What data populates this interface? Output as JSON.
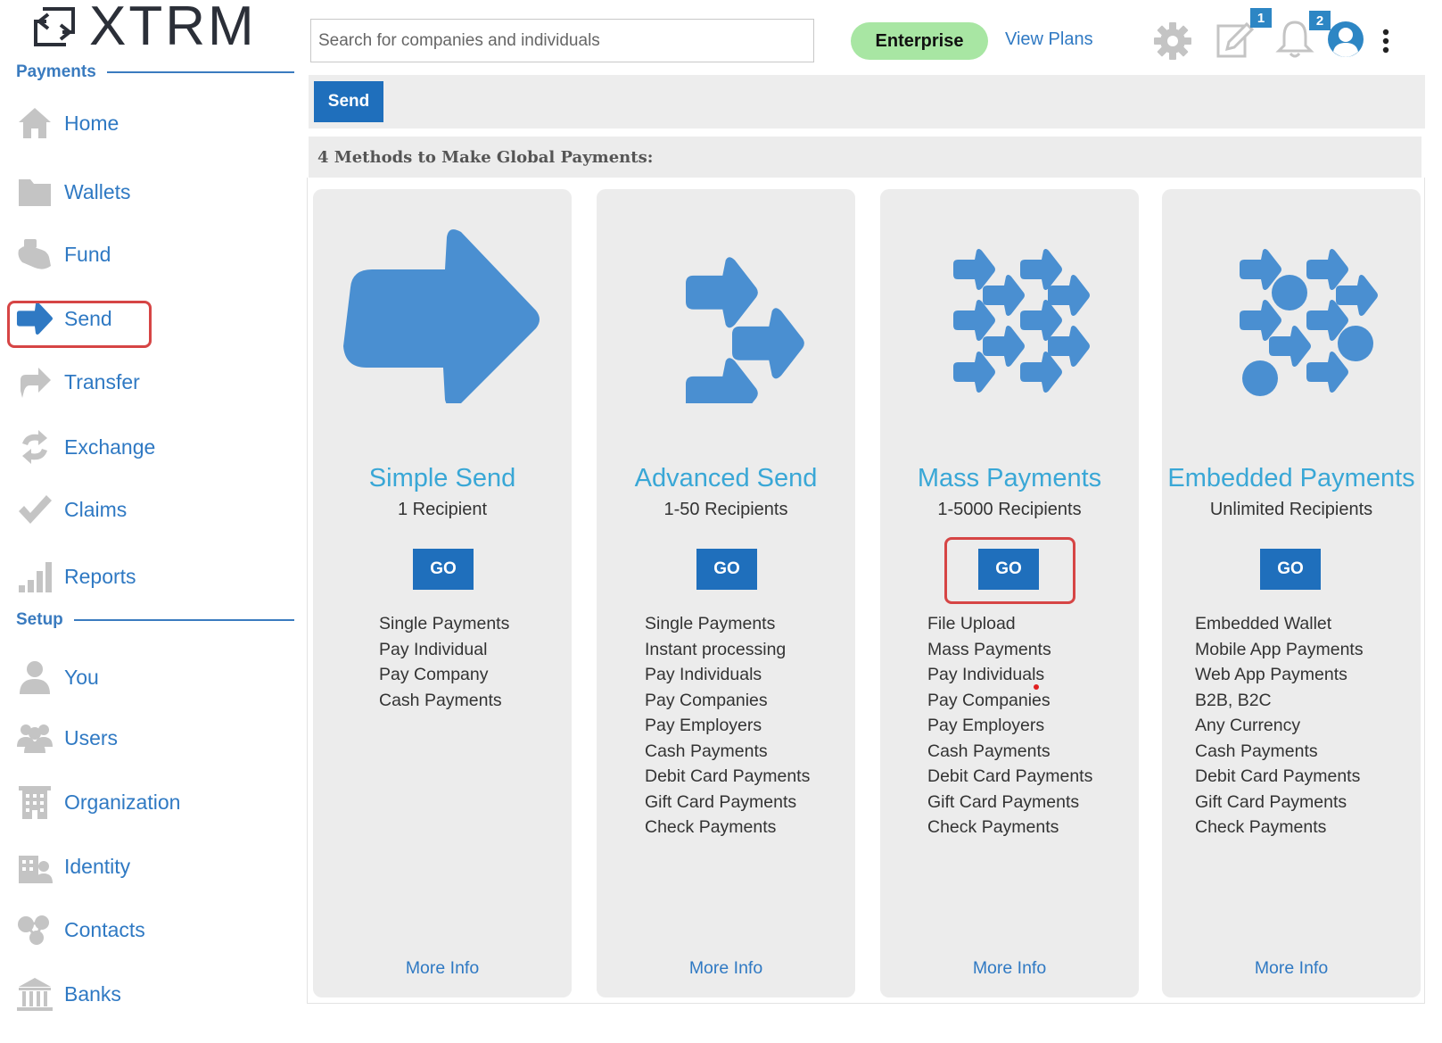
{
  "app": {
    "logo_text": "XTRM"
  },
  "header": {
    "search_placeholder": "Search for companies and individuals",
    "plan_badge": "Enterprise",
    "view_plans": "View Plans",
    "notes_count": "1",
    "notifications_count": "2"
  },
  "sidebar": {
    "payments_heading": "Payments",
    "setup_heading": "Setup",
    "payments_items": [
      {
        "label": "Home",
        "icon": "home-icon"
      },
      {
        "label": "Wallets",
        "icon": "folder-icon"
      },
      {
        "label": "Fund",
        "icon": "hand-icon"
      },
      {
        "label": "Send",
        "icon": "send-arrow-icon"
      },
      {
        "label": "Transfer",
        "icon": "transfer-icon"
      },
      {
        "label": "Exchange",
        "icon": "exchange-icon"
      },
      {
        "label": "Claims",
        "icon": "check-icon"
      },
      {
        "label": "Reports",
        "icon": "bar-chart-icon"
      }
    ],
    "setup_items": [
      {
        "label": "You",
        "icon": "user-icon"
      },
      {
        "label": "Users",
        "icon": "users-icon"
      },
      {
        "label": "Organization",
        "icon": "building-icon"
      },
      {
        "label": "Identity",
        "icon": "identity-icon"
      },
      {
        "label": "Contacts",
        "icon": "contacts-icon"
      },
      {
        "label": "Banks",
        "icon": "bank-icon"
      }
    ]
  },
  "main": {
    "action_button": "Send",
    "methods_heading": "4 Methods to Make Global Payments:",
    "cards": [
      {
        "title": "Simple Send",
        "subtitle": "1 Recipient",
        "go": "GO",
        "features": [
          "Single Payments",
          "Pay Individual",
          "Pay Company",
          "Cash Payments"
        ],
        "more": "More Info"
      },
      {
        "title": "Advanced Send",
        "subtitle": "1-50 Recipients",
        "go": "GO",
        "features": [
          "Single Payments",
          "Instant processing",
          "Pay Individuals",
          "Pay Companies",
          "Pay Employers",
          "Cash Payments",
          "Debit Card Payments",
          "Gift Card Payments",
          "Check Payments"
        ],
        "more": "More Info"
      },
      {
        "title": "Mass Payments",
        "subtitle": "1-5000 Recipients",
        "go": "GO",
        "features": [
          "File Upload",
          "Mass Payments",
          "Pay Individuals",
          "Pay Companies",
          "Pay Employers",
          "Cash Payments",
          "Debit Card Payments",
          "Gift Card Payments",
          "Check Payments"
        ],
        "more": "More Info"
      },
      {
        "title": "Embedded Payments",
        "subtitle": "Unlimited Recipients",
        "go": "GO",
        "features": [
          "Embedded Wallet",
          "Mobile App Payments",
          "Web App Payments",
          "B2B, B2C",
          "Any Currency",
          "Cash Payments",
          "Debit Card Payments",
          "Gift Card Payments",
          "Check Payments"
        ],
        "more": "More Info"
      }
    ]
  },
  "colors": {
    "accent_blue": "#1f6fbc",
    "link_blue": "#2f79c3",
    "title_blue": "#39a7d6",
    "icon_blue": "#4a8fd1",
    "plan_green": "#a8e6a3",
    "highlight_red": "#d64545"
  }
}
